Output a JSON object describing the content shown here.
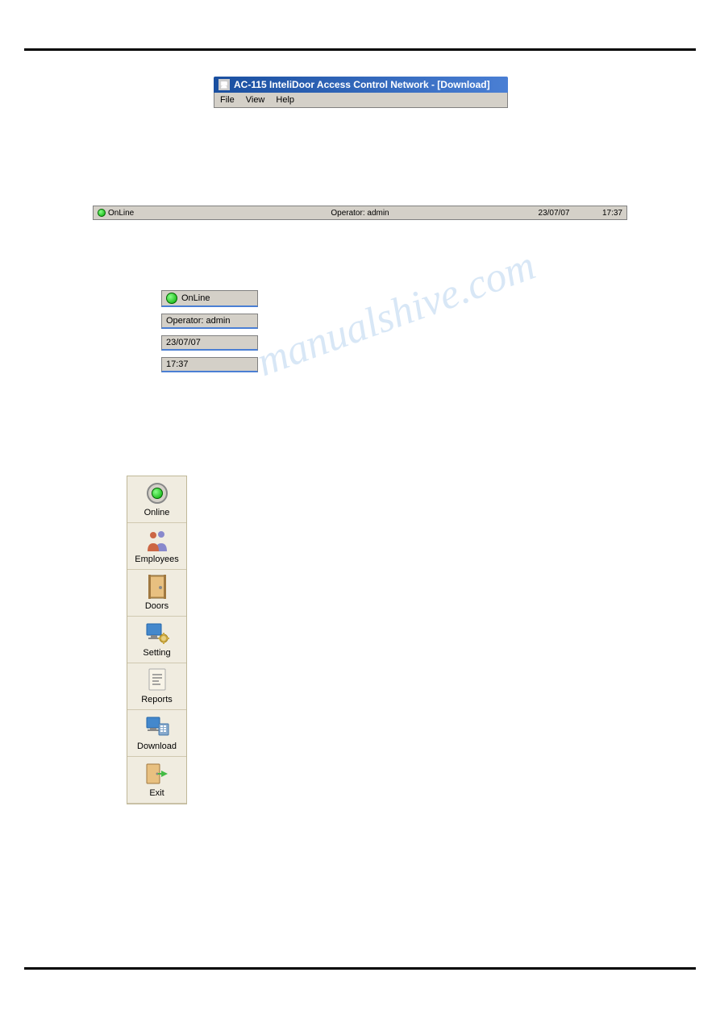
{
  "app": {
    "title": "AC-115 InteliDoor Access Control Network - [Download]",
    "menu": {
      "file": "File",
      "view": "View",
      "help": "Help"
    }
  },
  "status": {
    "online_label": "OnLine",
    "operator_label": "Operator: admin",
    "date": "23/07/07",
    "time": "17:37"
  },
  "info_boxes": {
    "online": "OnLine",
    "operator": "Operator: admin",
    "date": "23/07/07",
    "time": "17:37"
  },
  "sidebar": {
    "items": [
      {
        "id": "online",
        "label": "Online"
      },
      {
        "id": "employees",
        "label": "Employees"
      },
      {
        "id": "doors",
        "label": "Doors"
      },
      {
        "id": "setting",
        "label": "Setting"
      },
      {
        "id": "reports",
        "label": "Reports"
      },
      {
        "id": "download",
        "label": "Download"
      },
      {
        "id": "exit",
        "label": "Exit"
      }
    ]
  },
  "watermark": "manualshive.com"
}
